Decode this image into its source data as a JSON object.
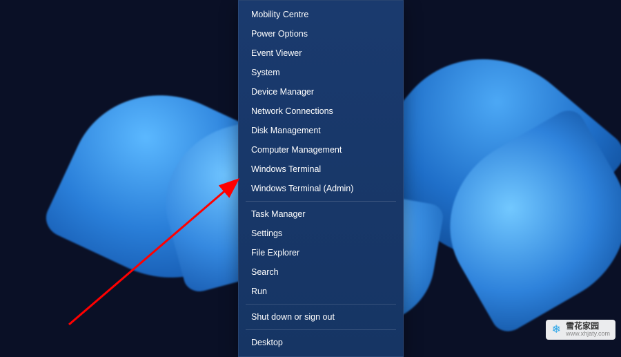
{
  "menu": {
    "items": [
      {
        "id": "mobility-centre",
        "label": "Mobility Centre"
      },
      {
        "id": "power-options",
        "label": "Power Options"
      },
      {
        "id": "event-viewer",
        "label": "Event Viewer"
      },
      {
        "id": "system",
        "label": "System"
      },
      {
        "id": "device-manager",
        "label": "Device Manager"
      },
      {
        "id": "network-connections",
        "label": "Network Connections"
      },
      {
        "id": "disk-management",
        "label": "Disk Management"
      },
      {
        "id": "computer-management",
        "label": "Computer Management"
      },
      {
        "id": "windows-terminal",
        "label": "Windows Terminal"
      },
      {
        "id": "windows-terminal-admin",
        "label": "Windows Terminal (Admin)"
      },
      {
        "id": "task-manager",
        "label": "Task Manager"
      },
      {
        "id": "settings",
        "label": "Settings"
      },
      {
        "id": "file-explorer",
        "label": "File Explorer"
      },
      {
        "id": "search",
        "label": "Search"
      },
      {
        "id": "run",
        "label": "Run"
      },
      {
        "id": "shut-down",
        "label": "Shut down or sign out"
      },
      {
        "id": "desktop",
        "label": "Desktop"
      }
    ],
    "separatorAfter": [
      9,
      14,
      15
    ],
    "highlighted": "windows-terminal-admin"
  },
  "watermark": {
    "name_cn": "雪花家园",
    "url": "www.xhjaty.com"
  },
  "annotation": {
    "arrow_color": "#ff0000",
    "points_to": "windows-terminal-admin"
  }
}
